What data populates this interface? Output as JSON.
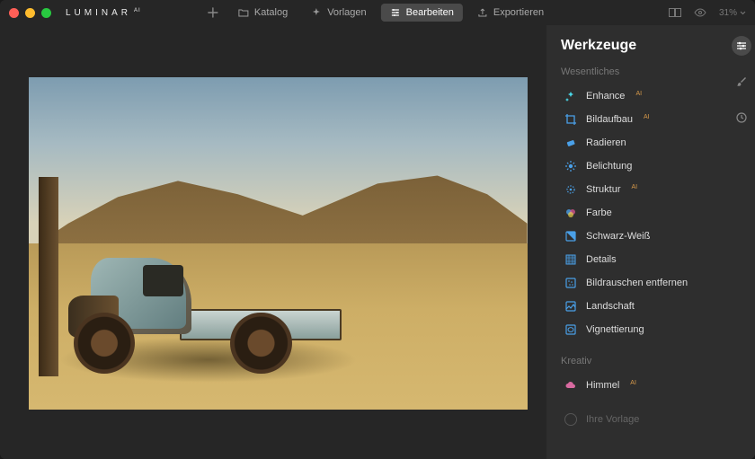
{
  "app": {
    "brand": "LUMINAR",
    "brand_suffix": "AI",
    "zoom": "31%"
  },
  "nav": {
    "catalog": "Katalog",
    "templates": "Vorlagen",
    "edit": "Bearbeiten",
    "export": "Exportieren"
  },
  "panel": {
    "title": "Werkzeuge",
    "sections": {
      "essentials": "Wesentliches",
      "creative": "Kreativ"
    },
    "tools": {
      "enhance": "Enhance",
      "composition": "Bildaufbau",
      "erase": "Radieren",
      "light": "Belichtung",
      "structure": "Struktur",
      "color": "Farbe",
      "bw": "Schwarz-Weiß",
      "details": "Details",
      "denoise": "Bildrauschen entfernen",
      "landscape": "Landschaft",
      "vignette": "Vignettierung",
      "sky": "Himmel"
    },
    "ai_badge": "AI",
    "footer": "Ihre Vorlage"
  },
  "colors": {
    "ai_orange": "#d89a4a",
    "sky_pink": "#d86aa0",
    "accent_blue": "#4aa0e8",
    "accent_cyan": "#4ad8e8"
  }
}
